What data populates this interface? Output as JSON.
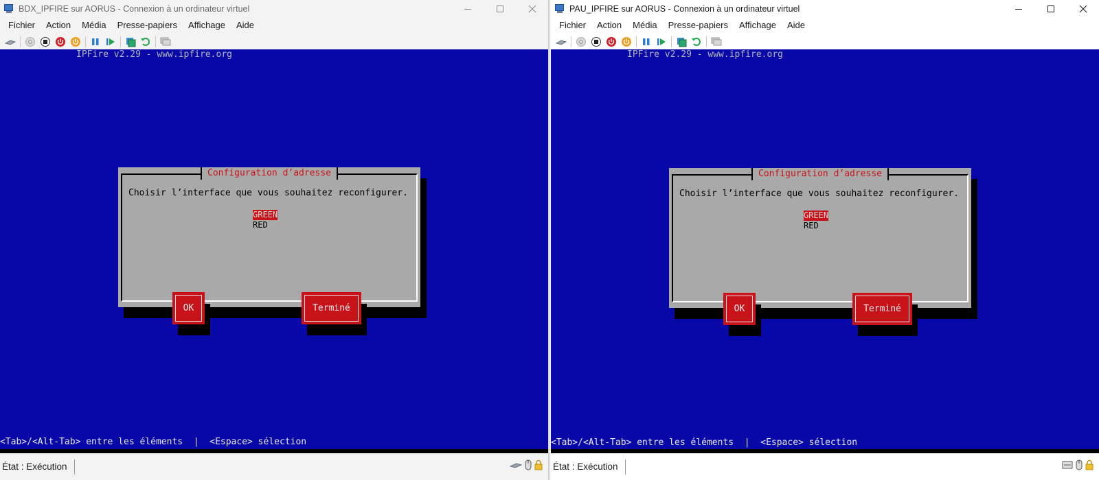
{
  "windows": [
    {
      "title": "BDX_IPFIRE sur AORUS - Connexion à un ordinateur virtuel",
      "menu": [
        "Fichier",
        "Action",
        "Média",
        "Presse-papiers",
        "Affichage",
        "Aide"
      ],
      "console": {
        "banner": "IPFire v2.29 - www.ipfire.org",
        "dialog_title": "Configuration d’adresse",
        "prompt": "Choisir l’interface que vous souhaitez reconfigurer.",
        "options": [
          "GREEN",
          "RED"
        ],
        "selected_option": "GREEN",
        "ok_label": "OK",
        "done_label": "Terminé",
        "hint": "<Tab>/<Alt-Tab> entre les éléments  |  <Espace> sélection"
      },
      "status": "État : Exécution"
    },
    {
      "title": "PAU_IPFIRE sur AORUS - Connexion à un ordinateur virtuel",
      "menu": [
        "Fichier",
        "Action",
        "Média",
        "Presse-papiers",
        "Affichage",
        "Aide"
      ],
      "console": {
        "banner": "IPFire v2.29 - www.ipfire.org",
        "dialog_title": "Configuration d’adresse",
        "prompt": "Choisir l’interface que vous souhaitez reconfigurer.",
        "options": [
          "GREEN",
          "RED"
        ],
        "selected_option": "GREEN",
        "ok_label": "OK",
        "done_label": "Terminé",
        "hint": "<Tab>/<Alt-Tab> entre les éléments  |  <Espace> sélection"
      },
      "status": "État : Exécution"
    }
  ],
  "toolbar_icons": [
    "ctrl-alt-del-icon",
    "start-icon",
    "turn-off-icon",
    "shutdown-icon",
    "power-icon",
    "pause-icon",
    "resume-icon",
    "checkpoint-icon",
    "revert-icon",
    "enhanced-session-icon"
  ],
  "colors": {
    "console_bg": "#0808a8",
    "dialog_bg": "#a9a9a9",
    "accent_red": "#c8131b"
  }
}
